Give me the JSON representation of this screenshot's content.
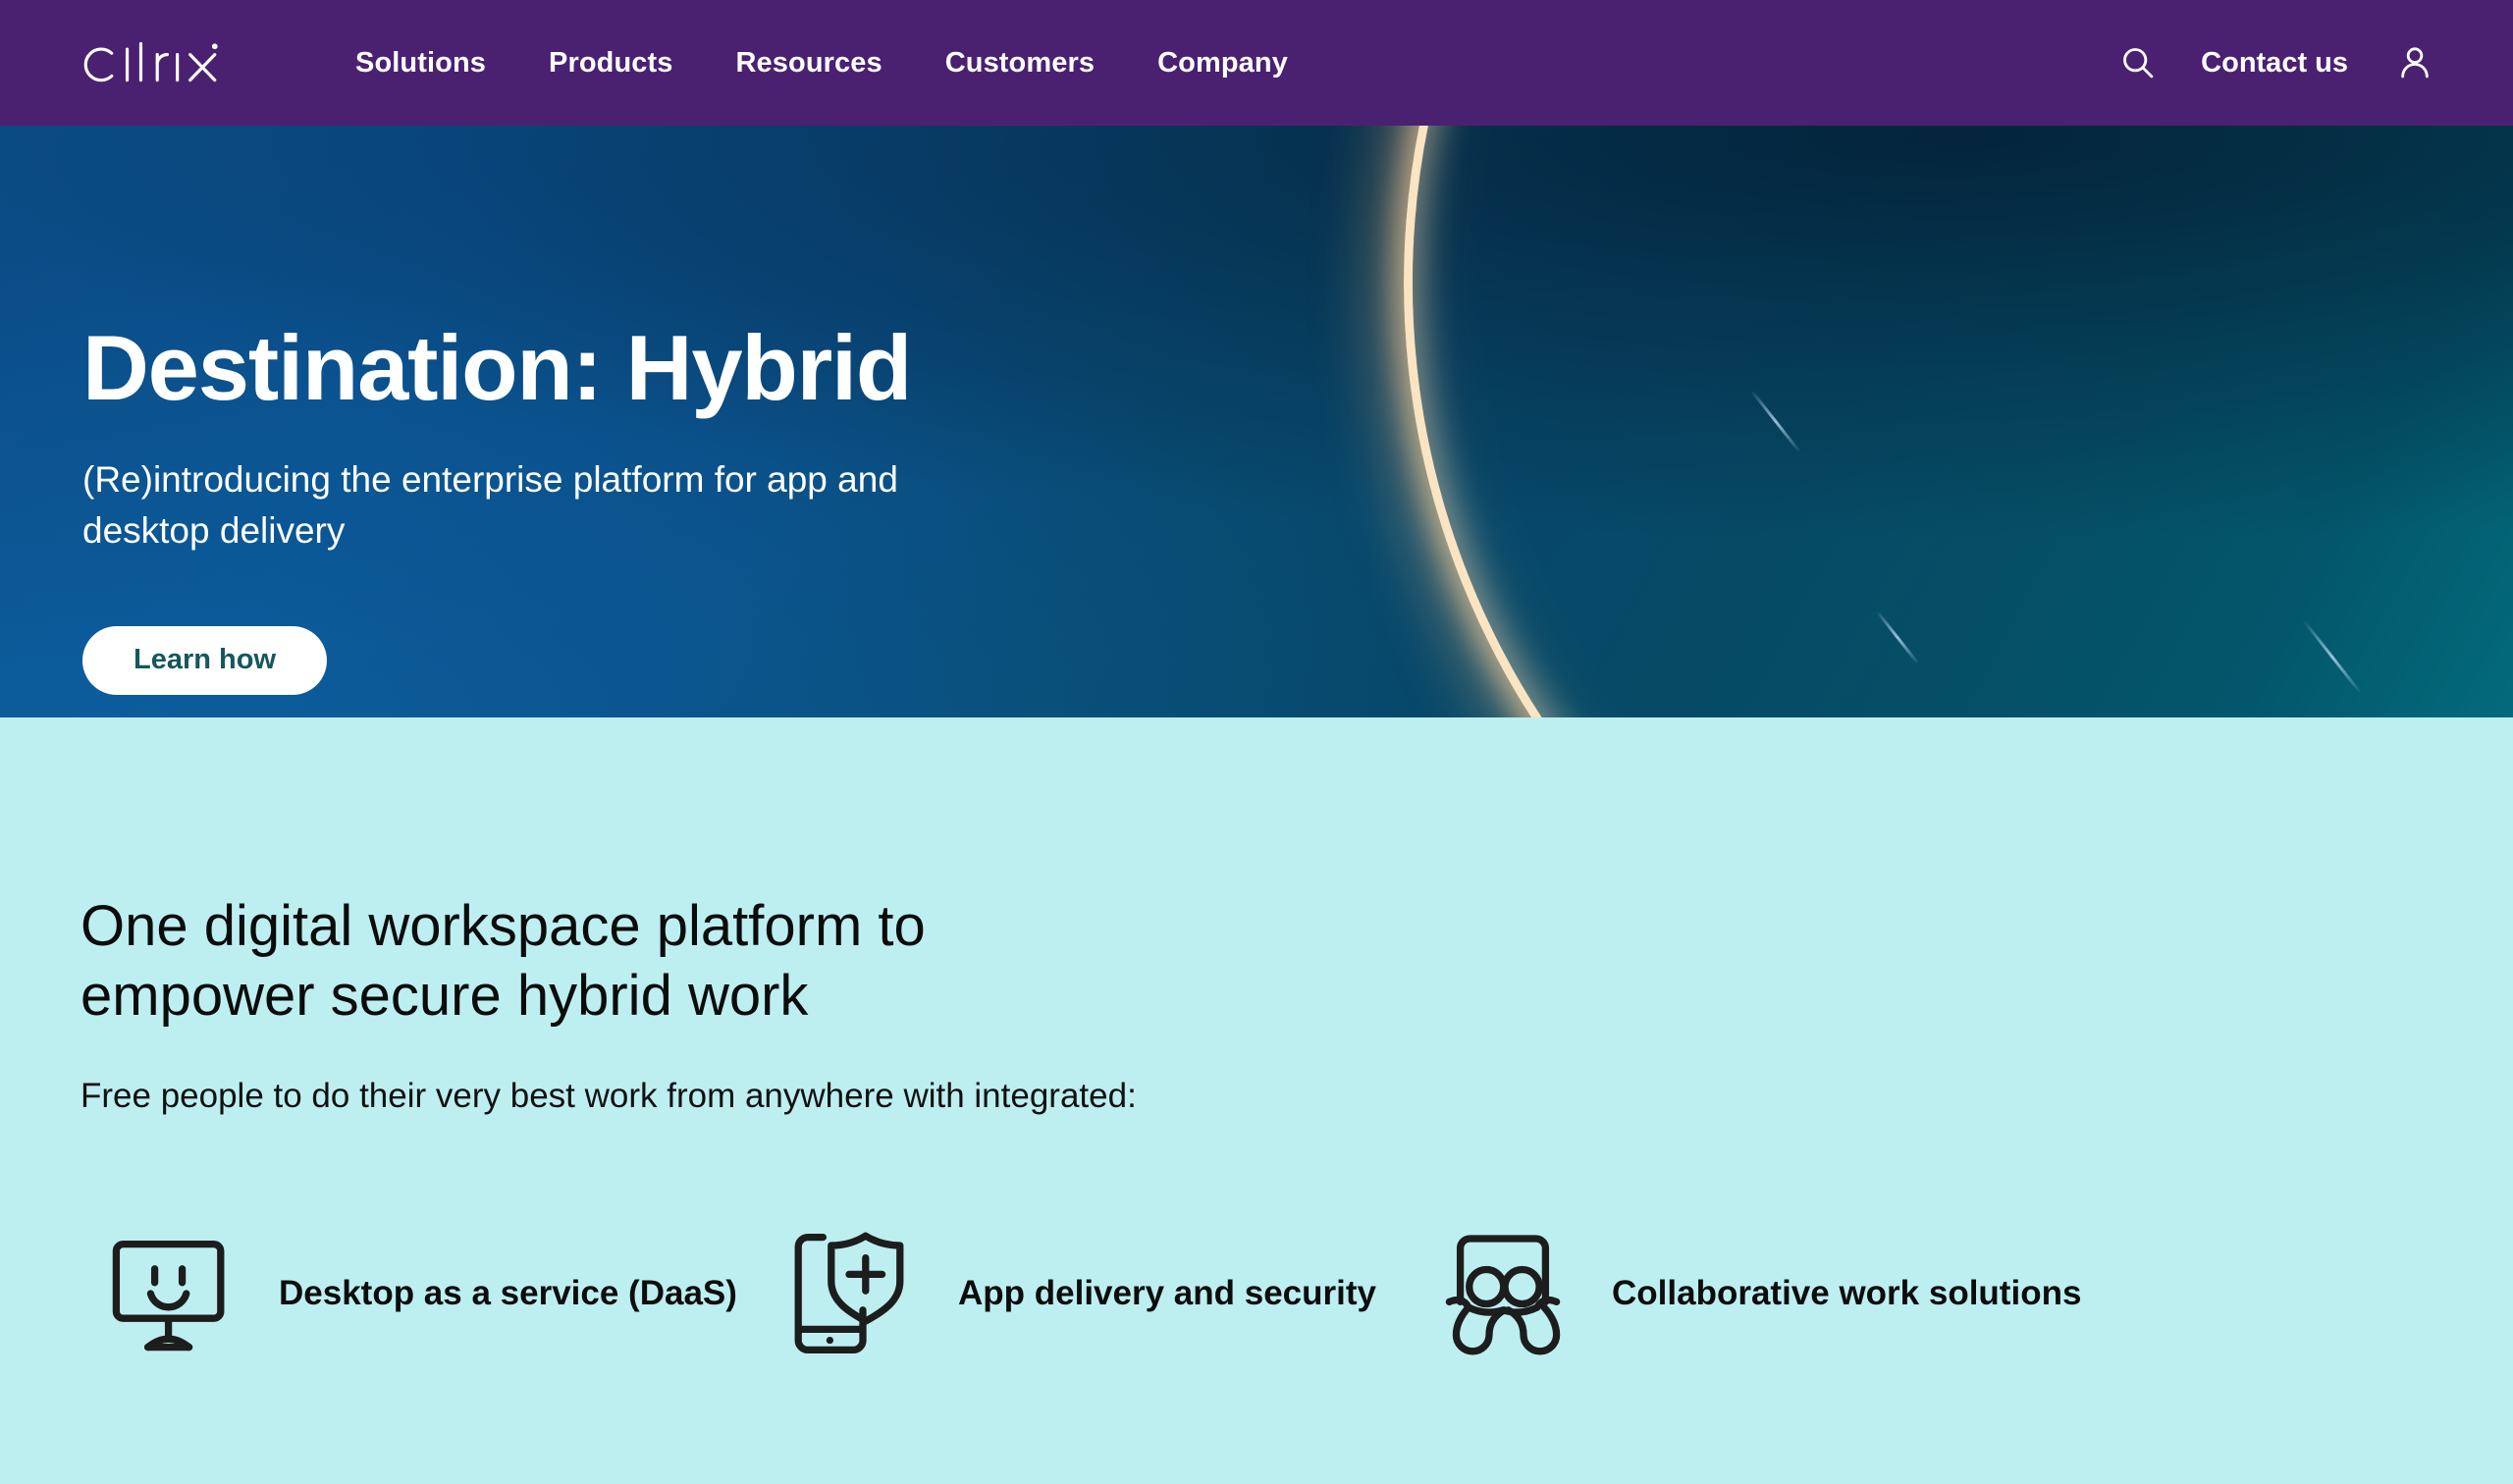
{
  "brand": {
    "name": "citrix",
    "purple": "#4a2171",
    "mint": "#bdeff1",
    "button_text_color": "#14585c"
  },
  "nav": {
    "logo_alt": "citrix",
    "items": [
      {
        "label": "Solutions"
      },
      {
        "label": "Products"
      },
      {
        "label": "Resources"
      },
      {
        "label": "Customers"
      },
      {
        "label": "Company"
      }
    ],
    "search_icon": "search-icon",
    "contact_label": "Contact us",
    "account_icon": "user-account-icon"
  },
  "hero": {
    "title": "Destination: Hybrid",
    "subtitle": "(Re)introducing the enterprise platform for app and desktop delivery",
    "cta_label": "Learn how"
  },
  "section": {
    "heading": "One digital workspace platform to empower secure hybrid work",
    "lead": "Free people to do their very best work from anywhere with integrated:",
    "features": [
      {
        "label": "Desktop as a service (DaaS)",
        "icon": "monitor-smile-icon"
      },
      {
        "label": "App delivery and security",
        "icon": "phone-shield-plus-icon"
      },
      {
        "label": "Collaborative work solutions",
        "icon": "collaboration-people-icon"
      }
    ]
  }
}
